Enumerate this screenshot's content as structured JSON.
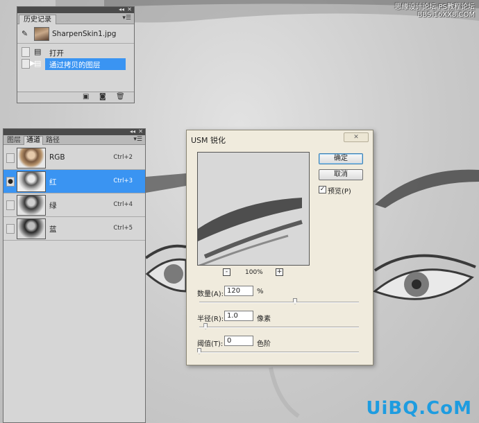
{
  "history_panel": {
    "tab_label": "历史记录",
    "snapshot_label": "SharpenSkin1.jpg",
    "steps": [
      {
        "label": "打开",
        "selected": false
      },
      {
        "label": "通过拷贝的图层",
        "selected": true
      }
    ]
  },
  "channels_panel": {
    "tabs": [
      "图层",
      "通道",
      "路径"
    ],
    "active_tab": "通道",
    "channels": [
      {
        "name": "RGB",
        "shortcut": "Ctrl+2",
        "visible": false,
        "selected": false
      },
      {
        "name": "红",
        "shortcut": "Ctrl+3",
        "visible": true,
        "selected": true
      },
      {
        "name": "绿",
        "shortcut": "Ctrl+4",
        "visible": false,
        "selected": false
      },
      {
        "name": "蓝",
        "shortcut": "Ctrl+5",
        "visible": false,
        "selected": false
      }
    ]
  },
  "usm_dialog": {
    "title": "USM 锐化",
    "ok_label": "确定",
    "cancel_label": "取消",
    "preview_label": "预览(P)",
    "preview_checked": true,
    "zoom_level": "100%",
    "zoom_out_label": "-",
    "zoom_in_label": "+",
    "amount": {
      "label": "数量(A):",
      "value": "120",
      "unit": "%",
      "slider_fraction": 0.6
    },
    "radius": {
      "label": "半径(R):",
      "value": "1.0",
      "unit": "像素",
      "slider_fraction": 0.04
    },
    "threshold": {
      "label": "阈值(T):",
      "value": "0",
      "unit": "色阶",
      "slider_fraction": 0.0
    }
  },
  "watermarks": {
    "top_line1": "思缘设计论坛",
    "top_line2": "PS教程论坛",
    "top_line3": "BBS.16XX8.COM",
    "bottom": "UiBQ.CoM"
  },
  "colors": {
    "selection_blue": "#3a94f2",
    "dialog_bg": "#f0ebdd",
    "watermark_blue": "#1e9ce0"
  }
}
